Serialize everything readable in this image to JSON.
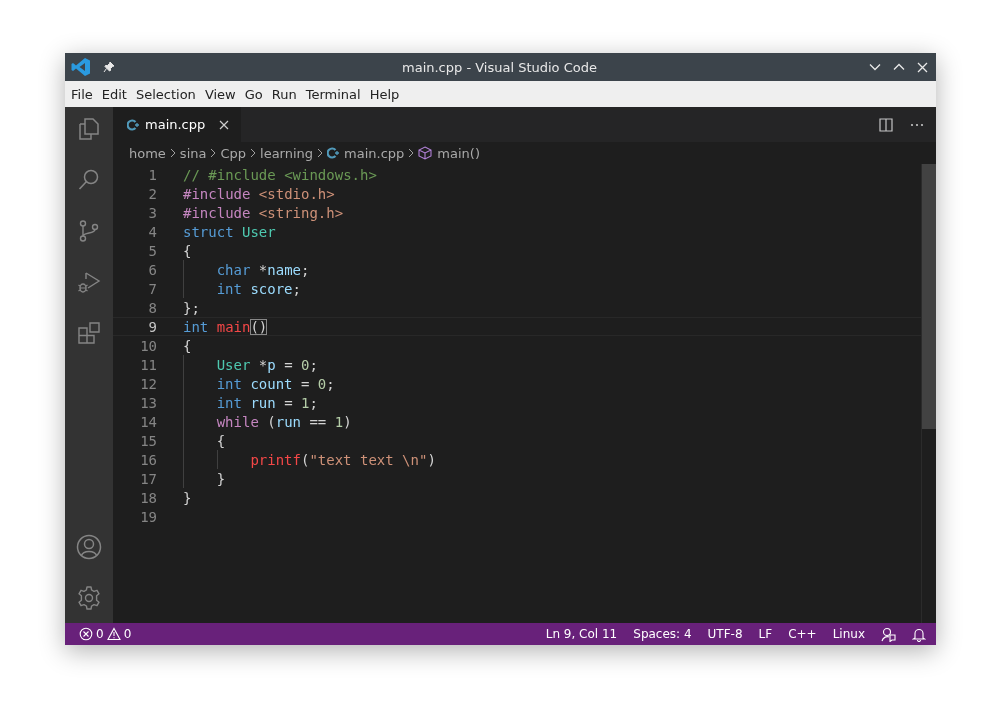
{
  "window": {
    "title": "main.cpp - Visual Studio Code"
  },
  "menu": [
    "File",
    "Edit",
    "Selection",
    "View",
    "Go",
    "Run",
    "Terminal",
    "Help"
  ],
  "tabs": [
    {
      "label": "main.cpp",
      "selected": true
    }
  ],
  "breadcrumbs": [
    {
      "kind": "folder",
      "label": "home"
    },
    {
      "kind": "folder",
      "label": "sina"
    },
    {
      "kind": "folder",
      "label": "Cpp"
    },
    {
      "kind": "folder",
      "label": "learning"
    },
    {
      "kind": "file",
      "label": "main.cpp"
    },
    {
      "kind": "symbol",
      "label": "main()"
    }
  ],
  "code": [
    {
      "number": "1",
      "selected": false,
      "tokens": [
        {
          "kind": "comment",
          "text": "// #include <windows.h>"
        }
      ]
    },
    {
      "number": "2",
      "selected": false,
      "tokens": [
        {
          "kind": "preproc",
          "text": "#include "
        },
        {
          "kind": "string",
          "text": "<stdio.h>"
        }
      ]
    },
    {
      "number": "3",
      "selected": false,
      "tokens": [
        {
          "kind": "preproc",
          "text": "#include "
        },
        {
          "kind": "string",
          "text": "<string.h>"
        }
      ]
    },
    {
      "number": "4",
      "selected": false,
      "tokens": [
        {
          "kind": "keyword",
          "text": "struct "
        },
        {
          "kind": "type",
          "text": "User"
        }
      ]
    },
    {
      "number": "5",
      "selected": false,
      "tokens": [
        {
          "kind": "plain",
          "text": "{"
        }
      ],
      "children": [
        {
          "number": "6",
          "selected": false,
          "tokens": [
            {
              "kind": "keyword",
              "text": "char "
            },
            {
              "kind": "plain",
              "text": "*"
            },
            {
              "kind": "variable",
              "text": "name"
            },
            {
              "kind": "plain",
              "text": ";"
            }
          ]
        },
        {
          "number": "7",
          "selected": false,
          "tokens": [
            {
              "kind": "keyword",
              "text": "int "
            },
            {
              "kind": "variable",
              "text": "score"
            },
            {
              "kind": "plain",
              "text": ";"
            }
          ]
        }
      ]
    },
    {
      "number": "8",
      "selected": false,
      "tokens": [
        {
          "kind": "plain",
          "text": "};"
        }
      ]
    },
    {
      "number": "9",
      "selected": true,
      "tokens": [
        {
          "kind": "keyword",
          "text": "int "
        },
        {
          "kind": "function",
          "text": "main"
        },
        {
          "kind": "match",
          "text": "()"
        }
      ]
    },
    {
      "number": "10",
      "selected": false,
      "tokens": [
        {
          "kind": "plain",
          "text": "{"
        }
      ],
      "children": [
        {
          "number": "11",
          "selected": false,
          "tokens": [
            {
              "kind": "type",
              "text": "User "
            },
            {
              "kind": "plain",
              "text": "*"
            },
            {
              "kind": "variable",
              "text": "p"
            },
            {
              "kind": "plain",
              "text": " = "
            },
            {
              "kind": "number",
              "text": "0"
            },
            {
              "kind": "plain",
              "text": ";"
            }
          ]
        },
        {
          "number": "12",
          "selected": false,
          "tokens": [
            {
              "kind": "keyword",
              "text": "int "
            },
            {
              "kind": "variable",
              "text": "count"
            },
            {
              "kind": "plain",
              "text": " = "
            },
            {
              "kind": "number",
              "text": "0"
            },
            {
              "kind": "plain",
              "text": ";"
            }
          ]
        },
        {
          "number": "13",
          "selected": false,
          "tokens": [
            {
              "kind": "keyword",
              "text": "int "
            },
            {
              "kind": "variable",
              "text": "run"
            },
            {
              "kind": "plain",
              "text": " = "
            },
            {
              "kind": "number",
              "text": "1"
            },
            {
              "kind": "plain",
              "text": ";"
            }
          ]
        },
        {
          "number": "14",
          "selected": false,
          "tokens": [
            {
              "kind": "control",
              "text": "while "
            },
            {
              "kind": "plain",
              "text": "("
            },
            {
              "kind": "variable",
              "text": "run"
            },
            {
              "kind": "plain",
              "text": " == "
            },
            {
              "kind": "number",
              "text": "1"
            },
            {
              "kind": "plain",
              "text": ")"
            }
          ]
        },
        {
          "number": "15",
          "selected": false,
          "tokens": [
            {
              "kind": "plain",
              "text": "{"
            }
          ],
          "children": [
            {
              "number": "16",
              "selected": false,
              "tokens": [
                {
                  "kind": "function",
                  "text": "printf"
                },
                {
                  "kind": "plain",
                  "text": "("
                },
                {
                  "kind": "string",
                  "text": "\"text text \\n\""
                },
                {
                  "kind": "plain",
                  "text": ")"
                }
              ]
            }
          ]
        },
        {
          "number": "17",
          "selected": false,
          "tokens": [
            {
              "kind": "plain",
              "text": "}"
            }
          ]
        }
      ]
    },
    {
      "number": "18",
      "selected": false,
      "tokens": [
        {
          "kind": "plain",
          "text": "}"
        }
      ]
    },
    {
      "number": "19",
      "selected": false
    }
  ],
  "status_bar": {
    "errors": "0",
    "warnings": "0",
    "items": [
      "Ln 9, Col 11",
      "Spaces: 4",
      "UTF-8",
      "LF",
      "C++",
      "Linux"
    ]
  }
}
